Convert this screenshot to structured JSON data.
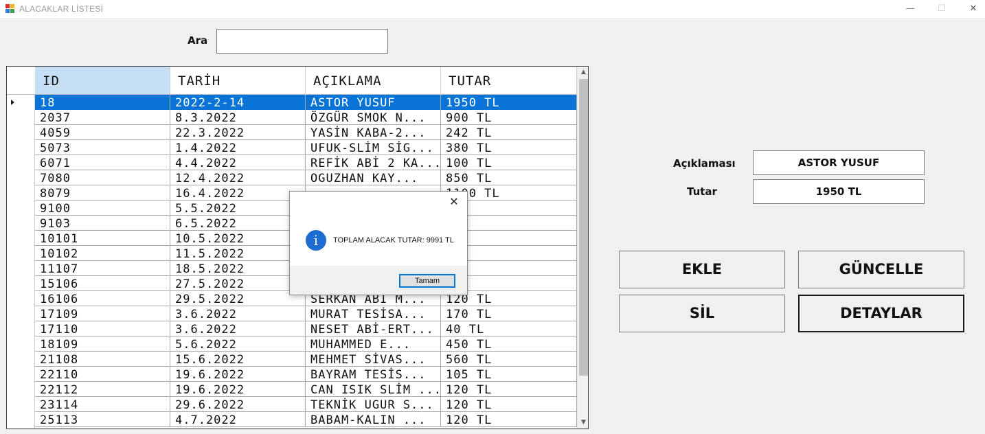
{
  "window": {
    "title": "ALACAKLAR LİSTESİ",
    "minimize": "—",
    "maximize": "☐",
    "close": "✕"
  },
  "search": {
    "label": "Ara",
    "value": "",
    "placeholder": ""
  },
  "grid": {
    "columns": [
      "ID",
      "TARİH",
      "AÇIKLAMA",
      "TUTAR"
    ],
    "rows": [
      [
        "18",
        "2022-2-14",
        "ASTOR YUSUF",
        "1950 TL"
      ],
      [
        "2037",
        "8.3.2022",
        "ÖZGÜR SMOK N...",
        "900 TL"
      ],
      [
        "4059",
        "22.3.2022",
        "YASİN KABA-2...",
        "242 TL"
      ],
      [
        "5073",
        "1.4.2022",
        "UFUK-SLİM SİG...",
        "380 TL"
      ],
      [
        "6071",
        "4.4.2022",
        "REFİK ABİ 2 KA...",
        "100 TL"
      ],
      [
        "7080",
        "12.4.2022",
        "OGUZHAN KAY...",
        "850 TL"
      ],
      [
        "8079",
        "16.4.2022",
        "",
        "1100 TL"
      ],
      [
        "9100",
        "5.5.2022",
        "",
        ""
      ],
      [
        "9103",
        "6.5.2022",
        "",
        ""
      ],
      [
        "10101",
        "10.5.2022",
        "",
        ""
      ],
      [
        "10102",
        "11.5.2022",
        "",
        ""
      ],
      [
        "11107",
        "18.5.2022",
        "",
        ""
      ],
      [
        "15106",
        "27.5.2022",
        "",
        ""
      ],
      [
        "16106",
        "29.5.2022",
        "SERKAN ABİ M...",
        "120 TL"
      ],
      [
        "17109",
        "3.6.2022",
        "MURAT TESİSA...",
        "170 TL"
      ],
      [
        "17110",
        "3.6.2022",
        "NESET ABİ-ERT...",
        "40 TL"
      ],
      [
        "18109",
        "5.6.2022",
        "MUHAMMED  E...",
        "450 TL"
      ],
      [
        "21108",
        "15.6.2022",
        "MEHMET SİVAS...",
        "560 TL"
      ],
      [
        "22110",
        "19.6.2022",
        "BAYRAM TESİS...",
        "105 TL"
      ],
      [
        "22112",
        "19.6.2022",
        "CAN ISIK SLİM ...",
        "120 TL"
      ],
      [
        "23114",
        "29.6.2022",
        "TEKNİK UGUR S...",
        "120 TL"
      ],
      [
        "25113",
        "4.7.2022",
        "BABAM-KALIN ...",
        "120 TL"
      ]
    ],
    "selected_row": 0
  },
  "details": {
    "aciklama_label": "Açıklaması",
    "aciklama_value": "ASTOR YUSUF",
    "tutar_label": "Tutar",
    "tutar_value": "1950 TL"
  },
  "buttons": {
    "ekle": "EKLE",
    "guncelle": "GÜNCELLE",
    "sil": "SİL",
    "detaylar": "DETAYLAR"
  },
  "dialog": {
    "icon": "i",
    "message": "TOPLAM ALACAK TUTAR: 9991 TL",
    "ok": "Tamam",
    "close": "✕"
  },
  "colors": {
    "selection": "#0a74d6",
    "header_selected": "#c6dff4",
    "info_icon": "#1c6cd1"
  }
}
